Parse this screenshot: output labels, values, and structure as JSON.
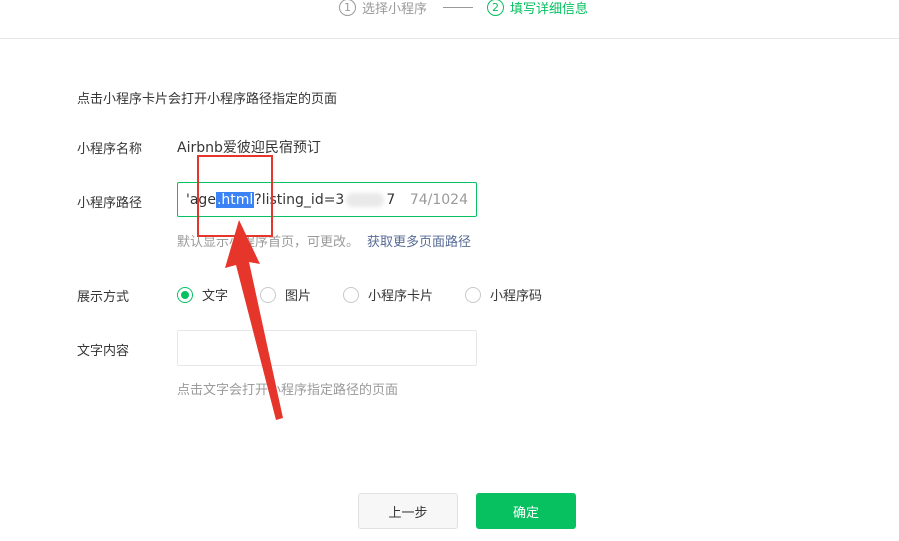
{
  "steps": [
    {
      "num": "1",
      "label": "选择小程序"
    },
    {
      "num": "2",
      "label": "填写详细信息"
    }
  ],
  "intro": "点击小程序卡片会打开小程序路径指定的页面",
  "app_name": {
    "label": "小程序名称",
    "value": "Airbnb爱彼迎民宿预订"
  },
  "app_path": {
    "label": "小程序路径",
    "prefix": "'age",
    "selected": ".html",
    "suffix": "?listing_id=3",
    "tail": "7",
    "counter": "74/1024",
    "hint": "默认显示小程序首页，可更改。",
    "hint_link": "获取更多页面路径"
  },
  "display_mode": {
    "label": "展示方式",
    "options": [
      "文字",
      "图片",
      "小程序卡片",
      "小程序码"
    ],
    "selected": "文字"
  },
  "text_content": {
    "label": "文字内容",
    "value": "",
    "hint": "点击文字会打开小程序指定路径的页面"
  },
  "buttons": {
    "prev": "上一步",
    "confirm": "确定"
  },
  "colors": {
    "accent": "#07c160",
    "link": "#576b95",
    "annotation": "#e6362b"
  }
}
